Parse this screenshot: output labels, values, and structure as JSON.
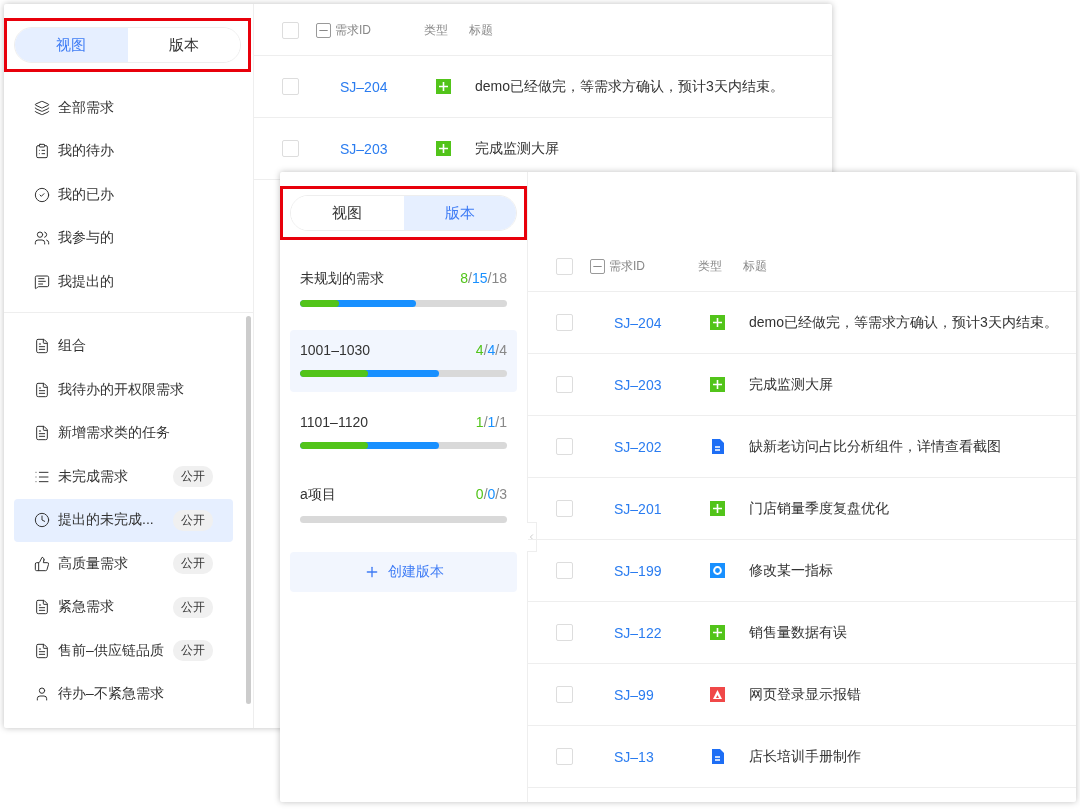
{
  "back_window": {
    "segments": [
      {
        "label": "视图",
        "selected": true
      },
      {
        "label": "版本",
        "selected": false
      }
    ],
    "nav_items": [
      {
        "label": "全部需求"
      },
      {
        "label": "我的待办"
      },
      {
        "label": "我的已办"
      },
      {
        "label": "我参与的"
      },
      {
        "label": "我提出的"
      }
    ],
    "views": [
      {
        "label": "组合",
        "selected": false
      },
      {
        "label": "我待办的开权限需求",
        "selected": false
      },
      {
        "label": "新增需求类的任务",
        "selected": false
      },
      {
        "label": "未完成需求",
        "badge": "公开",
        "selected": false
      },
      {
        "label": "提出的未完成...",
        "badge": "公开",
        "selected": true
      },
      {
        "label": "高质量需求",
        "badge": "公开",
        "selected": false
      },
      {
        "label": "紧急需求",
        "badge": "公开",
        "selected": false
      },
      {
        "label": "售前–供应链品质",
        "badge": "公开",
        "selected": false
      },
      {
        "label": "待办–不紧急需求",
        "selected": false
      }
    ],
    "table": {
      "select_all_checked": false,
      "columns": [
        "需求ID",
        "类型",
        "标题"
      ],
      "rows": [
        {
          "id": "SJ–204",
          "kind": "feature",
          "title": "demo已经做完，等需求方确认，预计3天内结束。",
          "checked": false
        },
        {
          "id": "SJ–203",
          "kind": "feature",
          "title": "完成监测大屏",
          "checked": false
        }
      ]
    }
  },
  "front_window": {
    "segments": [
      {
        "label": "视图",
        "selected": false
      },
      {
        "label": "版本",
        "selected": true
      }
    ],
    "versions": [
      {
        "name": "未规划的需求",
        "count": [
          {
            "text": "8",
            "color": "#52c41a"
          },
          {
            "text": "/",
            "color": "#888888"
          },
          {
            "text": "15",
            "color": "#1890ff"
          },
          {
            "text": "/",
            "color": "#888888"
          },
          {
            "text": "18",
            "color": "#888888"
          }
        ],
        "done_bar": {
          "level": 0.19
        },
        "progress_bar": {
          "level": 0.56
        },
        "selected": false
      },
      {
        "name": "1001–1030",
        "count": [
          {
            "text": "4",
            "color": "#52c41a"
          },
          {
            "text": "/",
            "color": "#888888"
          },
          {
            "text": "4",
            "color": "#1890ff"
          },
          {
            "text": "/",
            "color": "#888888"
          },
          {
            "text": "4",
            "color": "#888888"
          }
        ],
        "done_bar": {
          "level": 0.33
        },
        "progress_bar": {
          "level": 0.67
        },
        "selected": true
      },
      {
        "name": "1101–1120",
        "count": [
          {
            "text": "1",
            "color": "#52c41a"
          },
          {
            "text": "/",
            "color": "#888888"
          },
          {
            "text": "1",
            "color": "#1890ff"
          },
          {
            "text": "/",
            "color": "#888888"
          },
          {
            "text": "1",
            "color": "#888888"
          }
        ],
        "done_bar": {
          "level": 0.33
        },
        "progress_bar": {
          "level": 0.67
        },
        "selected": false
      },
      {
        "name": "a项目",
        "count": [
          {
            "text": "0",
            "color": "#52c41a"
          },
          {
            "text": "/",
            "color": "#888888"
          },
          {
            "text": "0",
            "color": "#1890ff"
          },
          {
            "text": "/",
            "color": "#888888"
          },
          {
            "text": "3",
            "color": "#888888"
          }
        ],
        "done_bar": {
          "level": 0
        },
        "progress_bar": {
          "level": 0
        },
        "selected": false
      }
    ],
    "create_button": "创建版本",
    "table": {
      "select_all_checked": false,
      "columns": [
        "需求ID",
        "类型",
        "标题"
      ],
      "rows": [
        {
          "id": "SJ–204",
          "kind": "feature",
          "title": "demo已经做完，等需求方确认，预计3天内结束。",
          "checked": false
        },
        {
          "id": "SJ–203",
          "kind": "feature",
          "title": "完成监测大屏",
          "checked": false
        },
        {
          "id": "SJ–202",
          "kind": "doc",
          "title": "缺新老访问占比分析组件，详情查看截图",
          "checked": false
        },
        {
          "id": "SJ–201",
          "kind": "feature",
          "title": "门店销量季度复盘优化",
          "checked": false
        },
        {
          "id": "SJ–199",
          "kind": "task",
          "title": "修改某一指标",
          "checked": false
        },
        {
          "id": "SJ–122",
          "kind": "feature",
          "title": "销售量数据有误",
          "checked": false
        },
        {
          "id": "SJ–99",
          "kind": "bug",
          "title": "网页登录显示报错",
          "checked": false
        },
        {
          "id": "SJ–13",
          "kind": "doc",
          "title": "店长培训手册制作",
          "checked": false
        }
      ]
    }
  }
}
